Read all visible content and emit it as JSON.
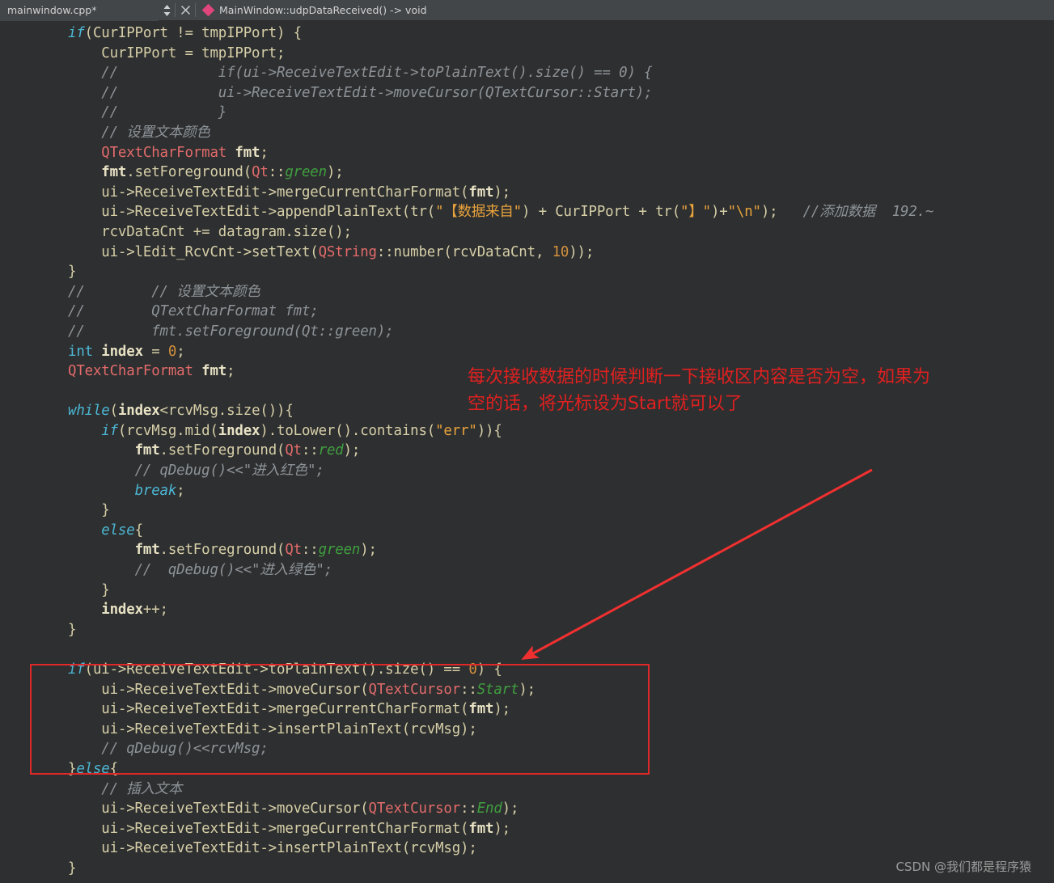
{
  "window": {
    "titlebar": {
      "tab_label": "mainwindow.cpp*",
      "spinbox_icon": "up-down-chevron-icon",
      "close_icon": "close-icon",
      "symbol_icon": "method-diamond-icon",
      "function_label": "MainWindow::udpDataReceived() -> void"
    }
  },
  "editor": {
    "language": "cpp",
    "background_color": "#2e2f30",
    "colors": {
      "keyword": "#4cb8d6",
      "type": "#e36b6b",
      "enum": "#3f9f3f",
      "string": "#e8a33d",
      "number": "#d4913d",
      "comment": "#8d9398",
      "plain": "#e8e2c4"
    },
    "lines": [
      "if(CurIPPort != tmpIPPort) {",
      "    CurIPPort = tmpIPPort;",
      "    //            if(ui->ReceiveTextEdit->toPlainText().size() == 0) {",
      "    //            ui->ReceiveTextEdit->moveCursor(QTextCursor::Start);",
      "    //            }",
      "    // 设置文本颜色",
      "    QTextCharFormat fmt;",
      "    fmt.setForeground(Qt::green);",
      "    ui->ReceiveTextEdit->mergeCurrentCharFormat(fmt);",
      "    ui->ReceiveTextEdit->appendPlainText(tr(\"【数据来自\") + CurIPPort + tr(\"】\")+\"\\n\");   //添加数据  192.~",
      "    rcvDataCnt += datagram.size();",
      "    ui->lEdit_RcvCnt->setText(QString::number(rcvDataCnt, 10));",
      "}",
      "//        // 设置文本颜色",
      "//        QTextCharFormat fmt;",
      "//        fmt.setForeground(Qt::green);",
      "int index = 0;",
      "QTextCharFormat fmt;",
      "",
      "while(index<rcvMsg.size()){",
      "    if(rcvMsg.mid(index).toLower().contains(\"err\")){",
      "        fmt.setForeground(Qt::red);",
      "        // qDebug()<<\"进入红色\";",
      "        break;",
      "    }",
      "    else{",
      "        fmt.setForeground(Qt::green);",
      "        //  qDebug()<<\"进入绿色\";",
      "    }",
      "    index++;",
      "}",
      "",
      "if(ui->ReceiveTextEdit->toPlainText().size() == 0) {",
      "    ui->ReceiveTextEdit->moveCursor(QTextCursor::Start);",
      "    ui->ReceiveTextEdit->mergeCurrentCharFormat(fmt);",
      "    ui->ReceiveTextEdit->insertPlainText(rcvMsg);",
      "    // qDebug()<<rcvMsg;",
      "}else{",
      "    // 插入文本",
      "    ui->ReceiveTextEdit->moveCursor(QTextCursor::End);",
      "    ui->ReceiveTextEdit->mergeCurrentCharFormat(fmt);",
      "    ui->ReceiveTextEdit->insertPlainText(rcvMsg);",
      "}"
    ]
  },
  "annotations": {
    "color": "#e02020",
    "note_text": "每次接收数据的时候判断一下接收区内容是否为空，如果为\n空的话，将光标设为Start就可以了",
    "highlight_box_label": "red-highlight-rectangle",
    "arrow_label": "red-pointer-arrow"
  },
  "watermark": {
    "text": "CSDN @我们都是程序猿"
  }
}
